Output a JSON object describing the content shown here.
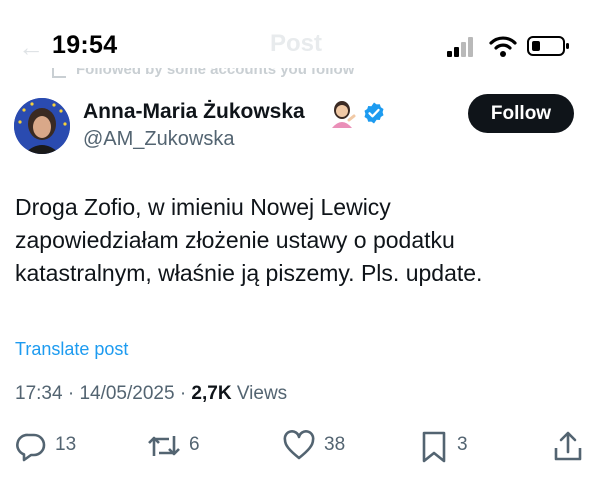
{
  "status_bar": {
    "time": "19:54"
  },
  "header": {
    "title": "Post"
  },
  "social_context": {
    "text": "Followed by some accounts you follow"
  },
  "author": {
    "name": "Anna-Maria Żukowska",
    "handle": "@AM_Zukowska",
    "emoji_icon": "woman-tipping-hand-emoji",
    "verified_color": "#1d9bf0"
  },
  "follow_button": {
    "label": "Follow"
  },
  "tweet": {
    "lines": [
      "Droga Zofio, w imieniu Nowej Lewicy",
      "zapowiedziałam złożenie ustawy o podatku",
      "katastralnym, właśnie ją piszemy. Pls. update."
    ]
  },
  "translate": {
    "label": "Translate post"
  },
  "meta": {
    "time": "17:34",
    "date": "14/05/2025",
    "views_count": "2,7K",
    "views_label": "Views"
  },
  "actions": {
    "replies": "13",
    "reposts": "6",
    "likes": "38",
    "bookmarks": "3"
  },
  "colors": {
    "accent": "#1d9bf0",
    "text": "#0f1419",
    "muted": "#536471"
  }
}
